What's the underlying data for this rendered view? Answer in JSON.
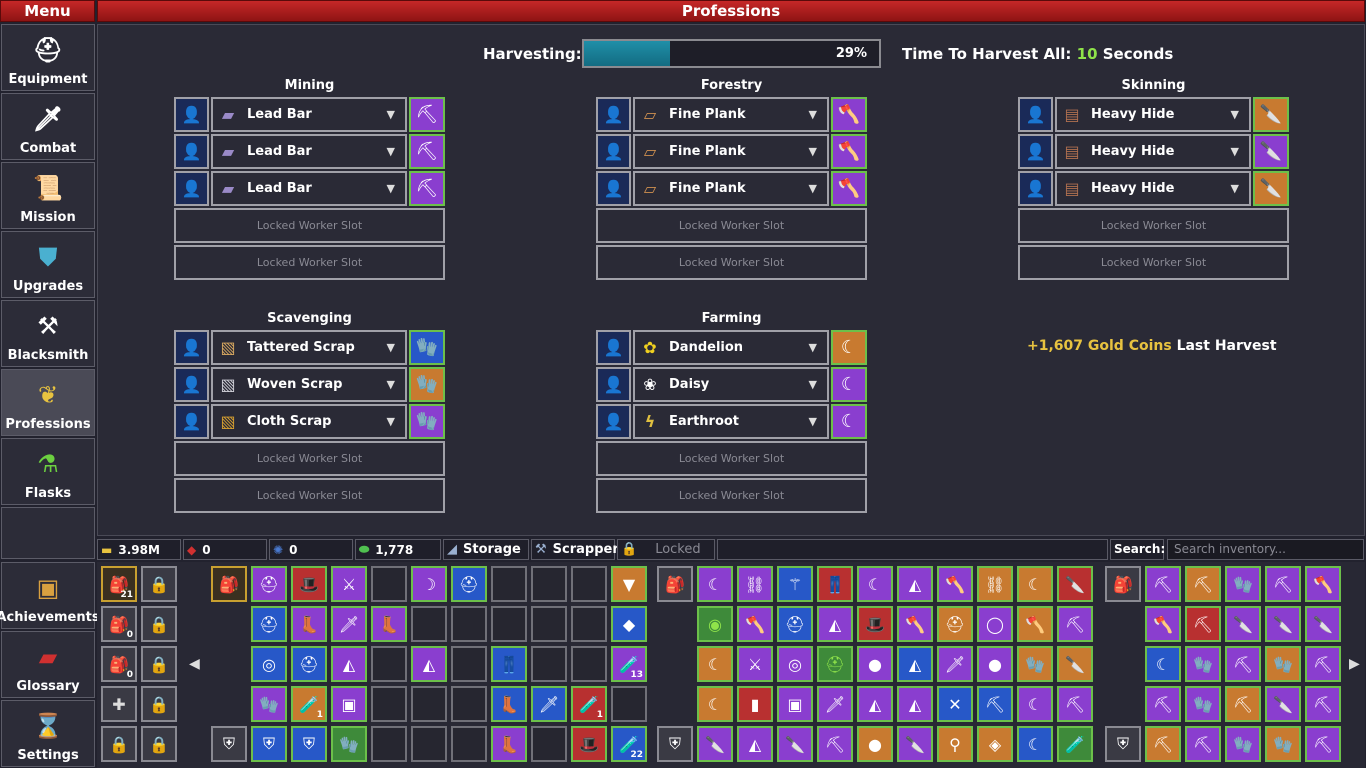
{
  "menu": {
    "title": "Menu"
  },
  "header": {
    "title": "Professions"
  },
  "nav": {
    "equipment": "Equipment",
    "combat": "Combat",
    "mission": "Mission",
    "upgrades": "Upgrades",
    "blacksmith": "Blacksmith",
    "professions": "Professions",
    "flasks": "Flasks",
    "achievements": "Achievements",
    "glossary": "Glossary",
    "settings": "Settings"
  },
  "harvest": {
    "label": "Harvesting:",
    "progress_percent": 29,
    "progress_text": "29%",
    "time_prefix": "Time To Harvest All:",
    "time_value": "10",
    "time_suffix": "Seconds"
  },
  "professions": {
    "mining": {
      "title": "Mining",
      "rows": [
        "Lead Bar",
        "Lead Bar",
        "Lead Bar"
      ]
    },
    "forestry": {
      "title": "Forestry",
      "rows": [
        "Fine Plank",
        "Fine Plank",
        "Fine Plank"
      ]
    },
    "skinning": {
      "title": "Skinning",
      "rows": [
        "Heavy Hide",
        "Heavy Hide",
        "Heavy Hide"
      ]
    },
    "scavenging": {
      "title": "Scavenging",
      "rows": [
        "Tattered Scrap",
        "Woven Scrap",
        "Cloth Scrap"
      ]
    },
    "farming": {
      "title": "Farming",
      "rows": [
        "Dandelion",
        "Daisy",
        "Earthroot"
      ]
    }
  },
  "locked_slot": "Locked Worker Slot",
  "last_harvest": {
    "prefix": "+",
    "amount": "1,607 Gold Coins",
    "suffix": "Last Harvest"
  },
  "status": {
    "gold": "3.98M",
    "res1": "0",
    "res2": "0",
    "res3": "1,778",
    "storage": "Storage",
    "scrapper": "Scrapper",
    "locked": "Locked",
    "search_label": "Search:",
    "search_placeholder": "Search inventory..."
  },
  "bag_counts": [
    "21",
    "0",
    "0"
  ],
  "inventory_counts": {
    "a": "13",
    "b": "1",
    "c": "1",
    "d": "22"
  },
  "colors": {
    "accent_red": "#c62828",
    "green": "#8fe34a",
    "gold": "#e8c340",
    "progress": "#1f8fa8"
  }
}
